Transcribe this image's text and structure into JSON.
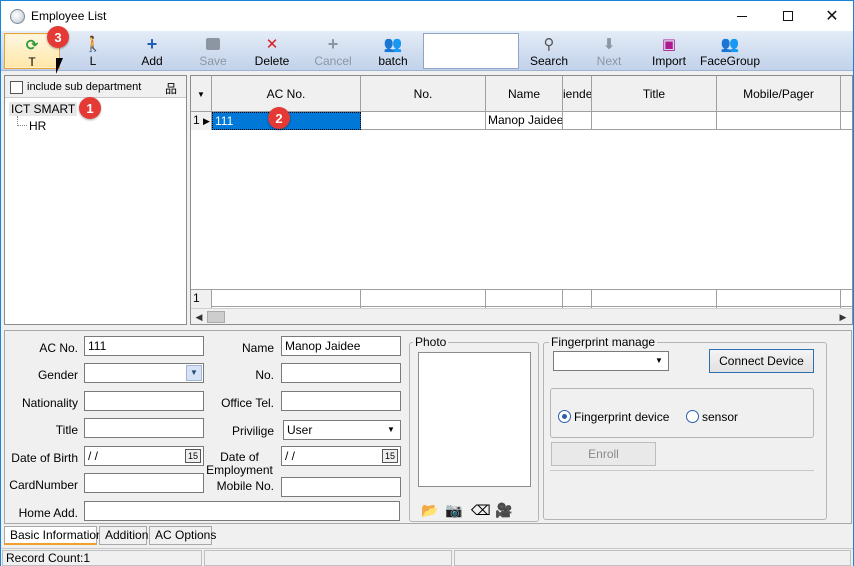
{
  "window": {
    "title": "Employee List"
  },
  "toolbar": {
    "buttons": [
      {
        "label": "T",
        "icon": "refresh-icon"
      },
      {
        "label": "L",
        "icon": "leave-icon"
      },
      {
        "label": "Add",
        "icon": "plus-icon"
      },
      {
        "label": "Save",
        "icon": "save-icon"
      },
      {
        "label": "Delete",
        "icon": "x-icon"
      },
      {
        "label": "Cancel",
        "icon": "plus-gray-icon"
      },
      {
        "label": "batch",
        "icon": "users-icon"
      },
      {
        "label": "Search",
        "icon": "search-icon"
      },
      {
        "label": "Next",
        "icon": "down-arrow-icon"
      },
      {
        "label": "Import",
        "icon": "import-icon"
      },
      {
        "label": "FaceGroup",
        "icon": "face-group-icon"
      }
    ]
  },
  "badges": [
    "3",
    "1",
    "2"
  ],
  "left_panel": {
    "include_sub_label": "include sub department",
    "tree_root": "ICT SMART",
    "tree_children": [
      "HR"
    ]
  },
  "grid": {
    "columns": [
      "AC No.",
      "No.",
      "Name",
      "iende",
      "Title",
      "Mobile/Pager"
    ],
    "rows": [
      {
        "index": "1",
        "ac_no": "111",
        "no": "",
        "name": "Manop Jaidee",
        "gender": "",
        "title": "",
        "mobile": ""
      }
    ],
    "footer_index": "1"
  },
  "form": {
    "ac_no_label": "AC No.",
    "ac_no": "111",
    "gender_label": "Gender",
    "gender": "",
    "nationality_label": "Nationality",
    "nationality": "",
    "title_label": "Title",
    "title": "",
    "dob_label": "Date of Birth",
    "dob": " /  /",
    "cardnumber_label": "CardNumber",
    "cardnumber": "",
    "home_add_label": "Home Add.",
    "home_add": "",
    "name_label": "Name",
    "name": "Manop Jaidee",
    "no_label": "No.",
    "no": "",
    "office_tel_label": "Office Tel.",
    "office_tel": "",
    "privilege_label": "Privilige",
    "privilege": "User",
    "doe_label": "Date of Employment",
    "doe": " /  /",
    "mobile_label": "Mobile No.",
    "mobile": "",
    "photo_label": "Photo",
    "fingerprint_label": "Fingerprint manage",
    "connect_label": "Connect Device",
    "fp_device_label": "Fingerprint device",
    "sensor_label": "sensor",
    "enroll_label": "Enroll",
    "cal_glyph": "15"
  },
  "tabs": [
    "Basic Information",
    "Addition",
    "AC Options"
  ],
  "status": {
    "record_count": "Record Count:1"
  }
}
